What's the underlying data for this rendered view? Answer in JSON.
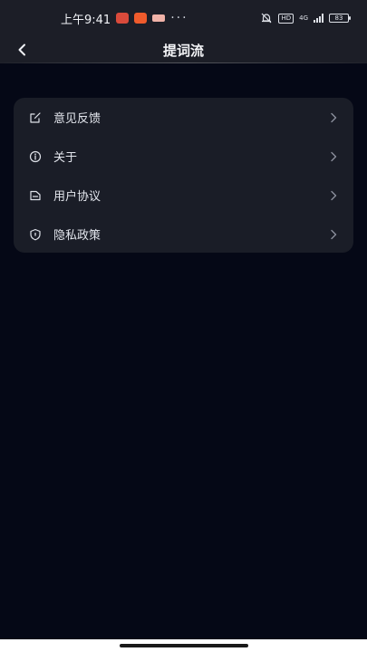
{
  "status_bar": {
    "time": "上午9:41",
    "dots": "···",
    "hd_label": "HD",
    "network_label": "4G",
    "battery_level": "83"
  },
  "nav": {
    "title": "提词流"
  },
  "settings": {
    "items": [
      {
        "label": "意见反馈",
        "icon": "feedback-edit-icon"
      },
      {
        "label": "关于",
        "icon": "info-icon"
      },
      {
        "label": "用户协议",
        "icon": "document-icon"
      },
      {
        "label": "隐私政策",
        "icon": "shield-icon"
      }
    ]
  },
  "colors": {
    "background": "#050816",
    "header": "#1c1e27",
    "card": "#1a1d27",
    "text": "#e4e7ee",
    "chevron": "#8a8f9c"
  }
}
